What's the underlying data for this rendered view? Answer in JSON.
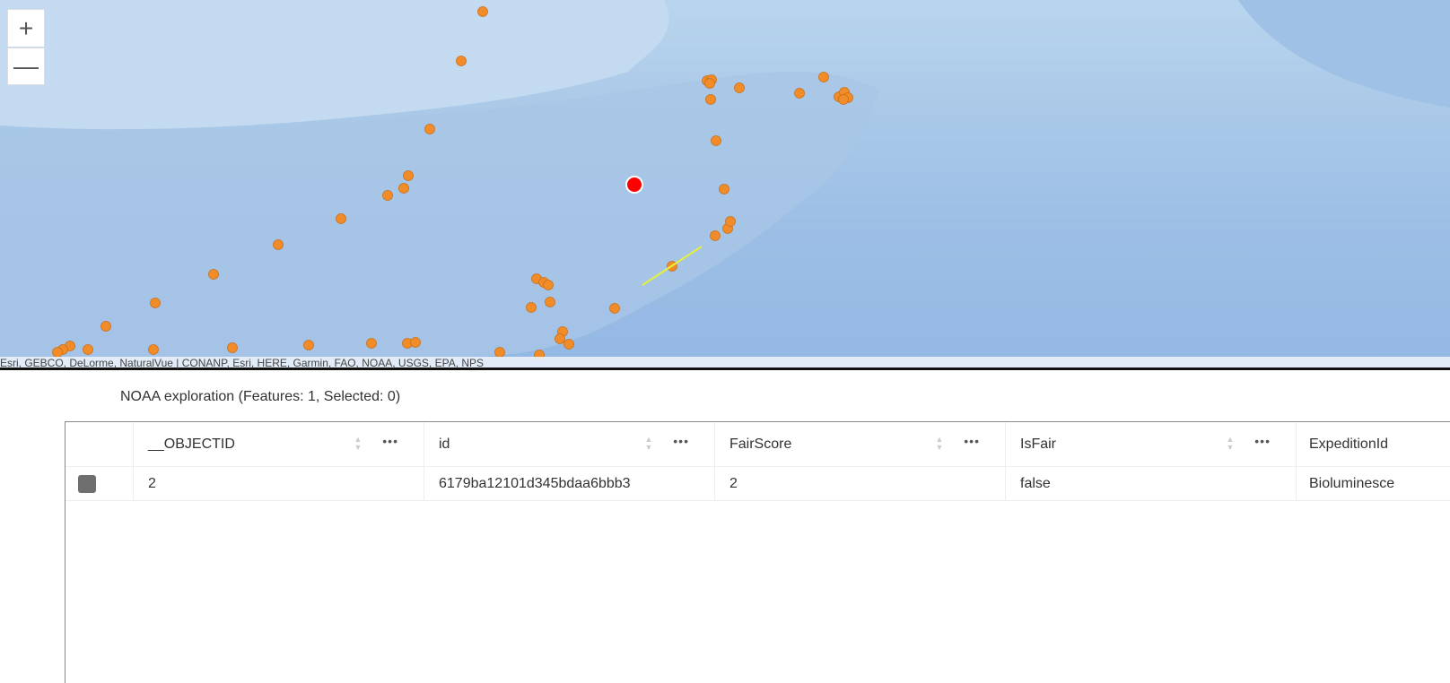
{
  "map": {
    "zoom_in": "+",
    "zoom_out": "—",
    "attribution": "Esri, GEBCO, DeLorme, NaturalVue | CONANP, Esri, HERE, Garmin, FAO, NOAA, USGS, EPA, NPS",
    "point_color": "#f28c28",
    "selected_color": "#ff0000",
    "line_color": "#e6f03c"
  },
  "table": {
    "title": "NOAA exploration (Features: 1, Selected: 0)",
    "columns": [
      "__OBJECTID",
      "id",
      "FairScore",
      "IsFair",
      "ExpeditionId"
    ],
    "rows": [
      [
        "2",
        "6179ba12101d345bdaa6bbb3",
        "2",
        "false",
        "Bioluminesce"
      ]
    ]
  }
}
